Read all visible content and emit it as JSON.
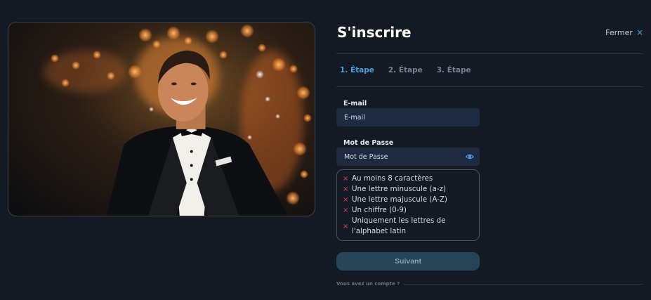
{
  "modal": {
    "title": "S'inscrire",
    "close_label": "Fermer",
    "close_icon": "×"
  },
  "steps": [
    {
      "label": "1. Étape",
      "active": true
    },
    {
      "label": "2. Étape",
      "active": false
    },
    {
      "label": "3. Étape",
      "active": false
    }
  ],
  "email": {
    "label": "E-mail",
    "placeholder": "E-mail"
  },
  "password": {
    "label": "Mot de Passe",
    "placeholder": "Mot de Passe",
    "toggle_icon": "eye-icon"
  },
  "password_rules": [
    "Au moins 8 caractères",
    "Une lettre minuscule (a-z)",
    "Une lettre majuscule (A-Z)",
    "Un chiffre (0-9)",
    "Uniquement les lettres de l'alphabet latin"
  ],
  "rule_icon": "×",
  "next_button": "Suivant",
  "account_prompt": "Vous avez un compte ?",
  "colors": {
    "accent": "#4aa3e0",
    "error": "#e04848",
    "background": "#141a23",
    "input_bg": "#1e2942",
    "button_bg": "#264358"
  }
}
